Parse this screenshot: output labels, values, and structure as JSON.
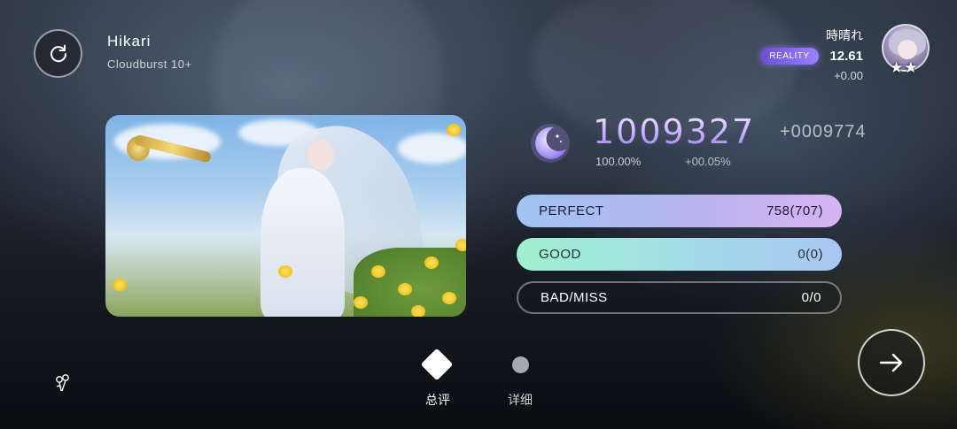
{
  "song": {
    "title": "Hikari",
    "difficulty": "Cloudburst 10+"
  },
  "player": {
    "name": "時晴れ",
    "badge": "REALITY",
    "rks": "12.61",
    "rks_delta": "+0.00",
    "stars": "★★"
  },
  "result": {
    "grade_icon": "moon-icon",
    "score": "1009327",
    "score_delta": "+0009774",
    "accuracy": "100.00%",
    "accuracy_delta": "+00.05%"
  },
  "judgements": [
    {
      "label": "PERFECT",
      "value": "758(707)"
    },
    {
      "label": "GOOD",
      "value": "0(0)"
    },
    {
      "label": "BAD/MISS",
      "value": "0/0"
    }
  ],
  "tabs": [
    {
      "label": "总评",
      "icon": "diamond-icon",
      "active": true
    },
    {
      "label": "详细",
      "icon": "dot-icon",
      "active": false
    }
  ],
  "colors": {
    "score_accent": "#c7aeff",
    "perfect_bar": "#b8b3f0",
    "good_bar": "#a3dbe9",
    "badge": "#7d64e6"
  }
}
